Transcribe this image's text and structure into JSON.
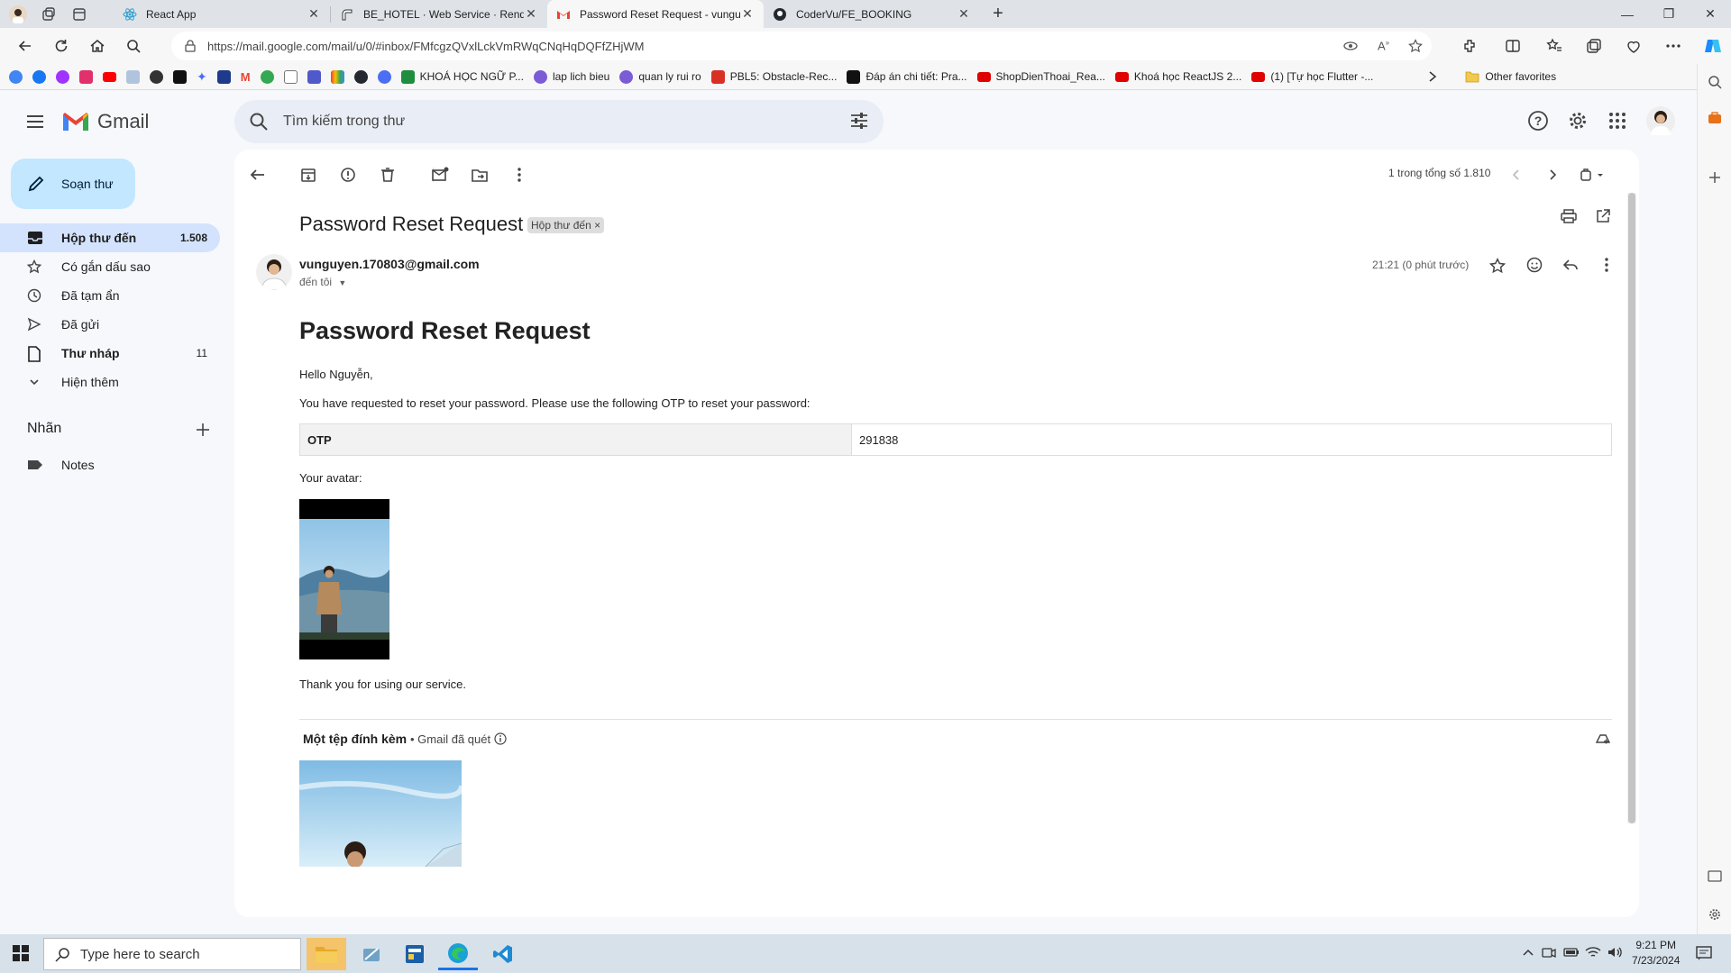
{
  "browser": {
    "tabs": [
      {
        "title": "React App",
        "icon": "react-icon"
      },
      {
        "title": "BE_HOTEL · Web Service · Render",
        "icon": "render-icon"
      },
      {
        "title": "Password Reset Request - vunguyen",
        "icon": "gmail-icon",
        "active": true
      },
      {
        "title": "CoderVu/FE_BOOKING",
        "icon": "github-icon"
      }
    ],
    "url": "https://mail.google.com/mail/u/0/#inbox/FMfcgzQVxlLckVmRWqCNqHqDQFfZHjWM",
    "bookmarks": [
      {
        "label": "KHOÁ HỌC NGỮ P...",
        "color": "#1e8e3e"
      },
      {
        "label": "lap lich bieu",
        "color": "#7b5cd6"
      },
      {
        "label": "quan ly rui ro",
        "color": "#7b5cd6"
      },
      {
        "label": "PBL5: Obstacle-Rec...",
        "color": "#d93025"
      },
      {
        "label": "Đáp án chi tiết: Pra...",
        "color": "#111111"
      },
      {
        "label": "ShopDienThoai_Rea...",
        "color": "#e00000"
      },
      {
        "label": "Khoá học ReactJS 2...",
        "color": "#e00000"
      },
      {
        "label": "(1) [Tự học Flutter -...",
        "color": "#e00000"
      }
    ],
    "other_favorites": "Other favorites"
  },
  "gmail": {
    "logo_text": "Gmail",
    "search_placeholder": "Tìm kiếm trong thư",
    "compose_label": "Soạn thư",
    "nav": [
      {
        "label": "Hộp thư đến",
        "count": "1.508",
        "icon": "inbox-icon",
        "selected": true
      },
      {
        "label": "Có gắn dấu sao",
        "count": "",
        "icon": "star-icon"
      },
      {
        "label": "Đã tạm ẩn",
        "count": "",
        "icon": "clock-icon"
      },
      {
        "label": "Đã gửi",
        "count": "",
        "icon": "send-icon"
      },
      {
        "label": "Thư nháp",
        "count": "11",
        "icon": "draft-icon",
        "bold": true
      },
      {
        "label": "Hiện thêm",
        "count": "",
        "icon": "chevron-down-icon"
      }
    ],
    "labels_heading": "Nhãn",
    "labels": [
      {
        "label": "Notes",
        "icon": "label-icon"
      }
    ],
    "pager_text": "1 trong tổng số 1.810"
  },
  "message": {
    "subject": "Password Reset Request",
    "chip": "Hộp thư đến",
    "sender": "vunguyen.170803@gmail.com",
    "to": "đến tôi",
    "time": "21:21 (0 phút trước)",
    "body": {
      "title": "Password Reset Request",
      "greeting": "Hello Nguyễn,",
      "intro": "You have requested to reset your password. Please use the following OTP to reset your password:",
      "otp_label": "OTP",
      "otp_value": "291838",
      "avatar_label": "Your avatar:",
      "thanks": "Thank you for using our service."
    },
    "attachments": {
      "heading": "Một tệp đính kèm",
      "scan_note": "• Gmail đã quét"
    }
  },
  "taskbar": {
    "search_placeholder": "Type here to search",
    "time": "9:21 PM",
    "date": "7/23/2024"
  },
  "colors": {
    "compose_bg": "#c2e7ff",
    "selected_nav_bg": "#d3e3fd",
    "gmail_bg": "#f6f8fc"
  }
}
